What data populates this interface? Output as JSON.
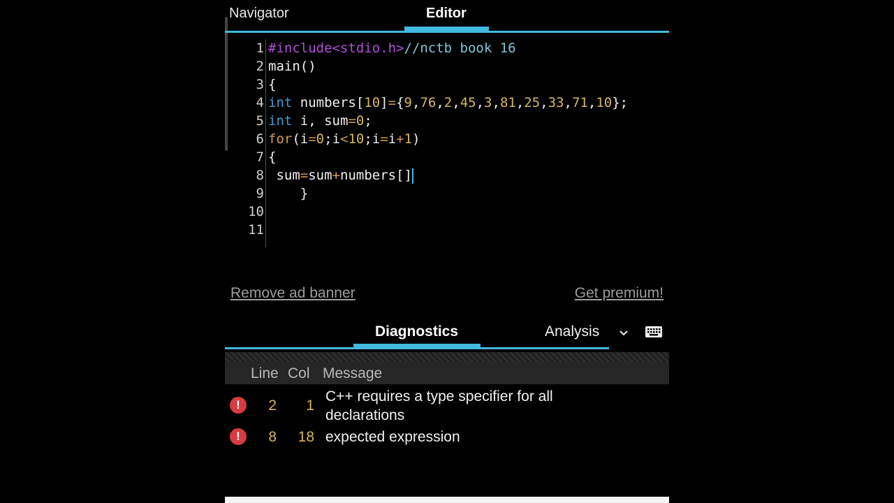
{
  "top_tabs": {
    "navigator": "Navigator",
    "editor": "Editor"
  },
  "editor": {
    "lines": [
      {
        "n": "1",
        "tokens": [
          {
            "t": "#include<stdio.h>",
            "c": "c-pre"
          },
          {
            "t": "//nctb book 16",
            "c": "c-comment"
          }
        ]
      },
      {
        "n": "2",
        "tokens": [
          {
            "t": "main()",
            "c": "c-txt"
          }
        ]
      },
      {
        "n": "3",
        "tokens": [
          {
            "t": "{",
            "c": "c-txt"
          }
        ]
      },
      {
        "n": "4",
        "tokens": [
          {
            "t": "int",
            "c": "c-key"
          },
          {
            "t": " numbers[",
            "c": "c-txt"
          },
          {
            "t": "10",
            "c": "c-num"
          },
          {
            "t": "]",
            "c": "c-txt"
          },
          {
            "t": "=",
            "c": "c-op"
          },
          {
            "t": "{",
            "c": "c-txt"
          },
          {
            "t": "9",
            "c": "c-num"
          },
          {
            "t": ",",
            "c": "c-txt"
          },
          {
            "t": "76",
            "c": "c-num"
          },
          {
            "t": ",",
            "c": "c-txt"
          },
          {
            "t": "2",
            "c": "c-num"
          },
          {
            "t": ",",
            "c": "c-txt"
          },
          {
            "t": "45",
            "c": "c-num"
          },
          {
            "t": ",",
            "c": "c-txt"
          },
          {
            "t": "3",
            "c": "c-num"
          },
          {
            "t": ",",
            "c": "c-txt"
          },
          {
            "t": "81",
            "c": "c-num"
          },
          {
            "t": ",",
            "c": "c-txt"
          },
          {
            "t": "25",
            "c": "c-num"
          },
          {
            "t": ",",
            "c": "c-txt"
          },
          {
            "t": "33",
            "c": "c-num"
          },
          {
            "t": ",",
            "c": "c-txt"
          },
          {
            "t": "71",
            "c": "c-num"
          },
          {
            "t": ",",
            "c": "c-txt"
          },
          {
            "t": "10",
            "c": "c-num"
          },
          {
            "t": "};",
            "c": "c-txt"
          }
        ]
      },
      {
        "n": "5",
        "tokens": [
          {
            "t": "int",
            "c": "c-key"
          },
          {
            "t": " i, sum",
            "c": "c-txt"
          },
          {
            "t": "=",
            "c": "c-op"
          },
          {
            "t": "0",
            "c": "c-num"
          },
          {
            "t": ";",
            "c": "c-txt"
          }
        ]
      },
      {
        "n": "6",
        "tokens": [
          {
            "t": "for",
            "c": "c-op"
          },
          {
            "t": "(i",
            "c": "c-txt"
          },
          {
            "t": "=",
            "c": "c-op"
          },
          {
            "t": "0",
            "c": "c-num"
          },
          {
            "t": ";i",
            "c": "c-txt"
          },
          {
            "t": "<",
            "c": "c-op"
          },
          {
            "t": "10",
            "c": "c-num"
          },
          {
            "t": ";i",
            "c": "c-txt"
          },
          {
            "t": "=",
            "c": "c-op"
          },
          {
            "t": "i",
            "c": "c-txt"
          },
          {
            "t": "+",
            "c": "c-op"
          },
          {
            "t": "1",
            "c": "c-num"
          },
          {
            "t": ")",
            "c": "c-txt"
          }
        ]
      },
      {
        "n": "7",
        "tokens": [
          {
            "t": "{",
            "c": "c-txt"
          }
        ]
      },
      {
        "n": "8",
        "tokens": [
          {
            "t": " sum",
            "c": "c-txt"
          },
          {
            "t": "=",
            "c": "c-op"
          },
          {
            "t": "sum",
            "c": "c-txt"
          },
          {
            "t": "+",
            "c": "c-op"
          },
          {
            "t": "numbers[]",
            "c": "c-txt"
          }
        ],
        "cursor": true
      },
      {
        "n": "9",
        "tokens": [
          {
            "t": "    }",
            "c": "c-txt"
          }
        ]
      },
      {
        "n": "10",
        "tokens": []
      },
      {
        "n": "11",
        "tokens": []
      }
    ]
  },
  "ad": {
    "remove": "Remove ad banner",
    "premium": "Get premium!"
  },
  "bottom_tabs": {
    "diagnostics": "Diagnostics",
    "analysis": "Analysis"
  },
  "diagnostics": {
    "headers": {
      "line": "Line",
      "col": "Col",
      "message": "Message"
    },
    "rows": [
      {
        "line": "2",
        "col": "1",
        "message": "C++ requires a type specifier for all declarations"
      },
      {
        "line": "8",
        "col": "18",
        "message": "expected expression"
      }
    ]
  },
  "colors": {
    "accent": "#41b8df",
    "error": "#d63c3f",
    "number": "#d7b75a"
  },
  "icons": {
    "error": "error-icon",
    "dropdown": "chevron-down-icon",
    "keyboard": "keyboard-icon"
  }
}
